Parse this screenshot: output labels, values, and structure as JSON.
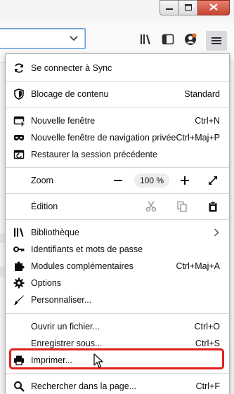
{
  "window": {
    "minimize_glyph": "—",
    "maximize_glyph": "□",
    "close_glyph": "✕"
  },
  "menu": {
    "sync": {
      "label": "Se connecter à Sync",
      "icon": "sync-icon"
    },
    "content_blocking": {
      "label": "Blocage de contenu",
      "value": "Standard",
      "icon": "shield-icon"
    },
    "new_window": {
      "label": "Nouvelle fenêtre",
      "shortcut": "Ctrl+N",
      "icon": "new-window-icon"
    },
    "private_window": {
      "label": "Nouvelle fenêtre de navigation privée",
      "shortcut": "Ctrl+Maj+P",
      "icon": "private-mask-icon"
    },
    "restore_session": {
      "label": "Restaurer la session précédente",
      "icon": "restore-session-icon"
    },
    "zoom": {
      "label": "Zoom",
      "minus": "—",
      "value": "100 %",
      "plus": "+"
    },
    "edit": {
      "label": "Édition"
    },
    "library": {
      "label": "Bibliothèque",
      "icon": "library-icon"
    },
    "logins": {
      "label": "Identifiants et mots de passe",
      "icon": "key-icon"
    },
    "addons": {
      "label": "Modules complémentaires",
      "shortcut": "Ctrl+Maj+A",
      "icon": "puzzle-icon"
    },
    "options": {
      "label": "Options",
      "icon": "gear-icon"
    },
    "customize": {
      "label": "Personnaliser...",
      "icon": "paintbrush-icon"
    },
    "open_file": {
      "label": "Ouvrir un fichier...",
      "shortcut": "Ctrl+O"
    },
    "save_as": {
      "label": "Enregistrer sous...",
      "shortcut": "Ctrl+S"
    },
    "print": {
      "label": "Imprimer...",
      "icon": "printer-icon"
    },
    "find": {
      "label": "Rechercher dans la page...",
      "shortcut": "Ctrl+F",
      "icon": "search-icon"
    }
  },
  "colors": {
    "highlight": "#e0201c",
    "panel_bg": "#ffffff",
    "separator": "#d7d7db"
  }
}
